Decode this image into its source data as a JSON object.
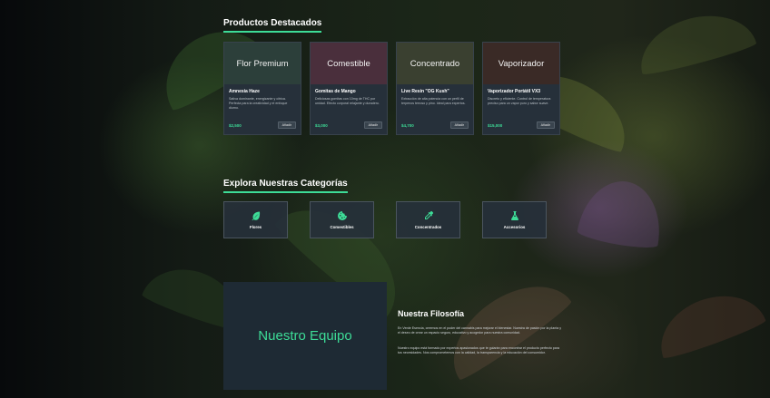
{
  "featured": {
    "title": "Productos Destacados",
    "products": [
      {
        "banner": "Flor Premium",
        "name": "Amnesia Haze",
        "desc": "Sativa dominante, energizante y cítrica. Perfecta para la creatividad y el enfoque diurno.",
        "price": "$2,500",
        "button": "Añadir",
        "color": "#2c3f3a"
      },
      {
        "banner": "Comestible",
        "name": "Gomitas de Mango",
        "desc": "Deliciosas gomitas con 10mg de THC por unidad. Efecto corporal relajante y duradero.",
        "price": "$3,000",
        "button": "Añadir",
        "color": "#4a2f3c"
      },
      {
        "banner": "Concentrado",
        "name": "Live Resin \"OG Kush\"",
        "desc": "Extracción de alta potencia con un perfil de terpenos terroso y pino. Ideal para expertos.",
        "price": "$4,700",
        "button": "Añadir",
        "color": "#3a4030"
      },
      {
        "banner": "Vaporizador",
        "name": "Vaporizador Portátil VX3",
        "desc": "Discreto y eficiente. Control de temperatura preciso para un vapor puro y sabor suave.",
        "price": "$15,000",
        "button": "Añadir",
        "color": "#3a2a26"
      }
    ]
  },
  "categories": {
    "title": "Explora Nuestras Categorías",
    "items": [
      {
        "label": "Flores",
        "icon": "leaf-icon"
      },
      {
        "label": "Comestibles",
        "icon": "cookie-icon"
      },
      {
        "label": "Concentrados",
        "icon": "dropper-icon"
      },
      {
        "label": "Accesorios",
        "icon": "flask-icon"
      }
    ]
  },
  "team": {
    "label": "Nuestro Equipo"
  },
  "philosophy": {
    "title": "Nuestra Filosofía",
    "p1": "En Verde Esencia, creemos en el poder del cannabis para mejorar el bienestar. Nuestra de pasión por la planta y el deseo de crear un espacio seguro, educativo y acogedor para nuestra comunidad.",
    "p2": "Nuestro equipo está formado por expertos apasionados que te guiarán para encontrar el producto perfecto para tus necesidades. Nos comprometemos con la calidad, la transparencia y la educación del consumidor."
  },
  "colors": {
    "accent": "#3ddc97",
    "card": "#26303a"
  }
}
